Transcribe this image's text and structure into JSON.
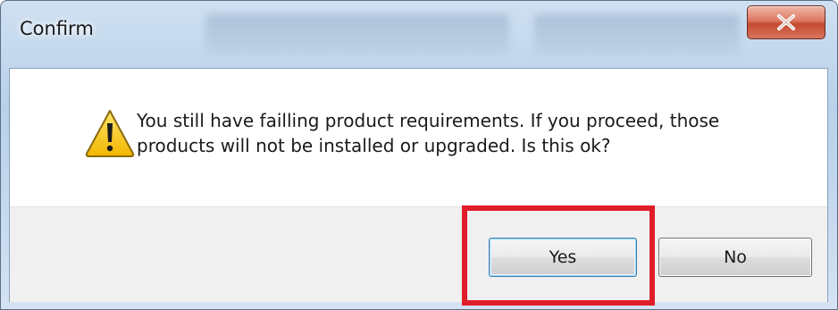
{
  "window": {
    "title": "Confirm",
    "close_label": "X"
  },
  "dialog": {
    "message_line1": "You still have failling product requirements.  If you proceed, those",
    "message_line2": "products will not be installed or upgraded.  Is this ok?",
    "icon": "warning-icon"
  },
  "buttons": {
    "yes_label": "Yes",
    "no_label": "No"
  },
  "annotation": {
    "highlight_color": "#e01e2a",
    "highlighted_element": "yes-button"
  }
}
